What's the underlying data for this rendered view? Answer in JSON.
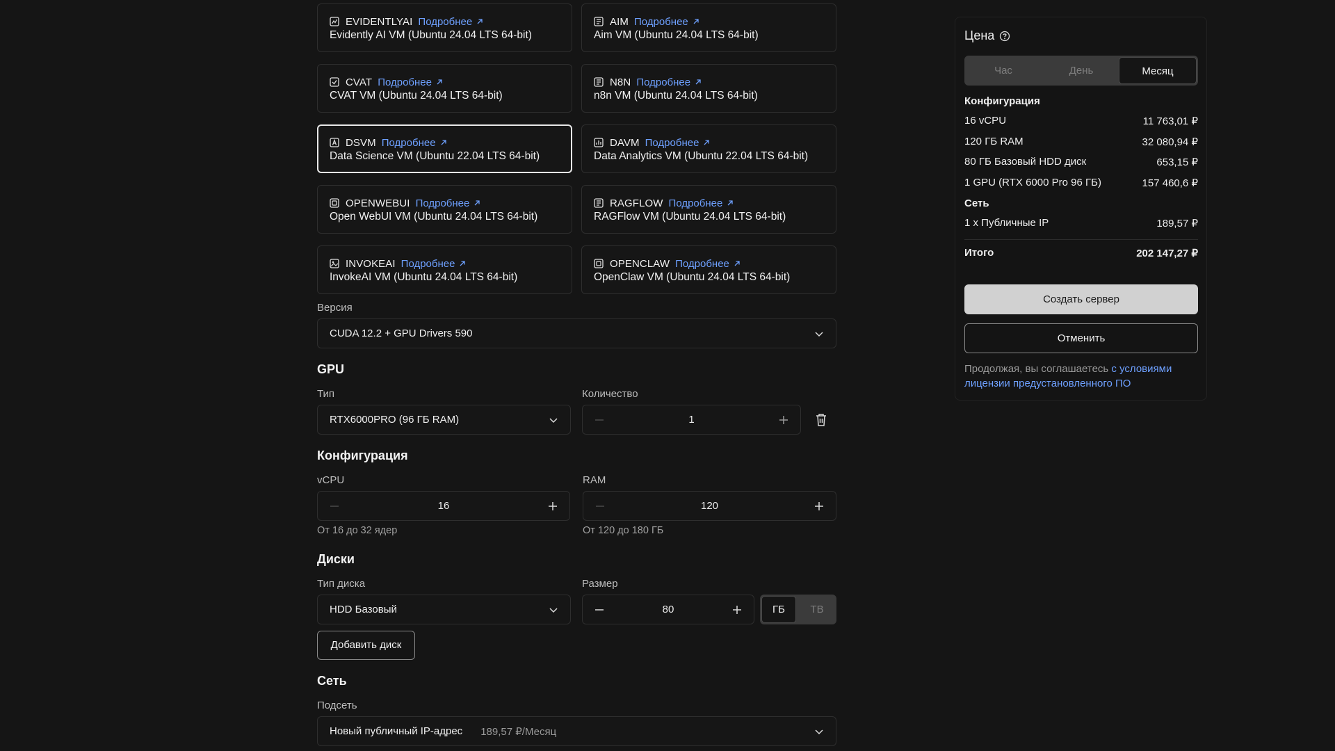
{
  "images": [
    {
      "code": "EVIDENTLYAI",
      "more": "Подробнее",
      "desc": "Evidently AI VM (Ubuntu 24.04 LTS 64-bit)",
      "selected": false
    },
    {
      "code": "AIM",
      "more": "Подробнее",
      "desc": "Aim VM (Ubuntu 24.04 LTS 64-bit)",
      "selected": false
    },
    {
      "code": "CVAT",
      "more": "Подробнее",
      "desc": "CVAT VM (Ubuntu 24.04 LTS 64-bit)",
      "selected": false
    },
    {
      "code": "N8N",
      "more": "Подробнее",
      "desc": "n8n VM (Ubuntu 24.04 LTS 64-bit)",
      "selected": false
    },
    {
      "code": "DSVM",
      "more": "Подробнее",
      "desc": "Data Science VM (Ubuntu 22.04 LTS 64-bit)",
      "selected": true
    },
    {
      "code": "DAVM",
      "more": "Подробнее",
      "desc": "Data Analytics VM (Ubuntu 22.04 LTS 64-bit)",
      "selected": false
    },
    {
      "code": "OPENWEBUI",
      "more": "Подробнее",
      "desc": "Open WebUI VM (Ubuntu 24.04 LTS 64-bit)",
      "selected": false
    },
    {
      "code": "RAGFLOW",
      "more": "Подробнее",
      "desc": "RAGFlow VM (Ubuntu 24.04 LTS 64-bit)",
      "selected": false
    },
    {
      "code": "INVOKEAI",
      "more": "Подробнее",
      "desc": "InvokeAI VM (Ubuntu 24.04 LTS 64-bit)",
      "selected": false
    },
    {
      "code": "OPENCLAW",
      "more": "Подробнее",
      "desc": "OpenClaw VM (Ubuntu 24.04 LTS 64-bit)",
      "selected": false
    }
  ],
  "version": {
    "label": "Версия",
    "value": "CUDA 12.2 + GPU Drivers 590"
  },
  "gpu": {
    "title": "GPU",
    "type_label": "Тип",
    "type_value": "RTX6000PRO (96 ГБ RAM)",
    "count_label": "Количество",
    "count_value": "1"
  },
  "config": {
    "title": "Конфигурация",
    "vcpu_label": "vCPU",
    "vcpu_value": "16",
    "vcpu_hint": "От 16 до 32 ядер",
    "ram_label": "RAM",
    "ram_value": "120",
    "ram_hint": "От 120 до 180 ГБ"
  },
  "disks": {
    "title": "Диски",
    "type_label": "Тип диска",
    "type_value": "HDD Базовый",
    "size_label": "Размер",
    "size_value": "80",
    "unit_gb": "ГБ",
    "unit_tb": "ТВ",
    "add_button": "Добавить диск"
  },
  "network": {
    "title": "Сеть",
    "subnet_label": "Подсеть",
    "subnet_value": "Новый публичный IP-адрес",
    "subnet_price": "189,57 ₽/Месяц"
  },
  "price": {
    "title": "Цена",
    "periods": [
      "Час",
      "День",
      "Месяц"
    ],
    "active_period": "Месяц",
    "config_label": "Конфигурация",
    "config_items": [
      {
        "name": "16 vCPU",
        "value": "11 763,01 ₽"
      },
      {
        "name": "120 ГБ RAM",
        "value": "32 080,94 ₽"
      },
      {
        "name": "80 ГБ Базовый HDD диск",
        "value": "653,15 ₽"
      },
      {
        "name": "1 GPU (RTX 6000 Pro 96 ГБ)",
        "value": "157 460,6 ₽"
      }
    ],
    "network_label": "Сеть",
    "network_items": [
      {
        "name": "1 x Публичные IP",
        "value": "189,57 ₽"
      }
    ],
    "total_label": "Итого",
    "total_value": "202 147,27 ₽",
    "create_button": "Создать сервер",
    "cancel_button": "Отменить",
    "legal_text": "Продолжая, вы соглашаетесь ",
    "legal_link": "с условиями лицензии предустановленного ПО"
  },
  "colors": {
    "accent_link": "#6ea0ff",
    "background": "#151515",
    "primary_button": "#d1d1d1"
  }
}
